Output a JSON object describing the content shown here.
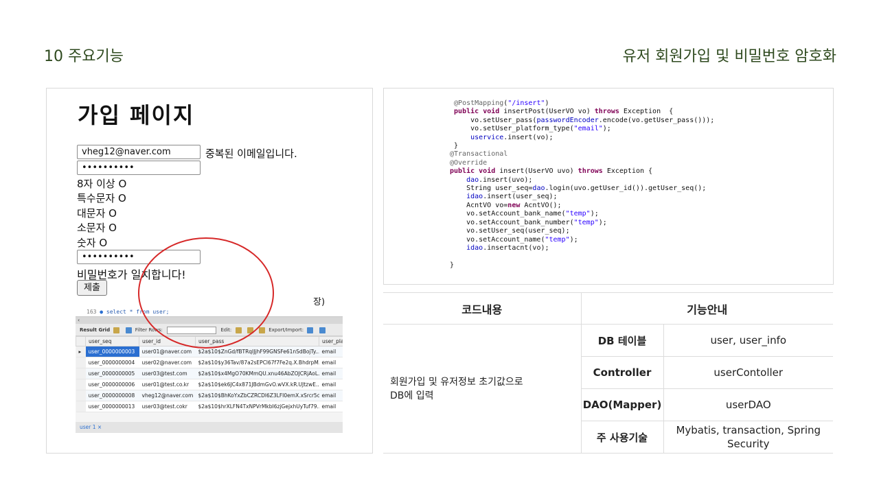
{
  "header": {
    "section": "10 주요기능",
    "topic": "유저 회원가입 및 비밀번호 암호화"
  },
  "signup": {
    "title": "가입 페이지",
    "email_value": "vheg12@naver.com",
    "email_message": "중복된 이메일입니다.",
    "password_value": "••••••••••",
    "rules": [
      "8자 이상 O",
      "특수문자 O",
      "대문자 O",
      "소문자 O",
      "숫자 O"
    ],
    "password_confirm_value": "••••••••••",
    "match_message": "비밀번호가 일치합니다!",
    "submit_label": "제출",
    "trailing_text": "장)"
  },
  "workbench": {
    "line_number": "163",
    "query": "select * from user;",
    "toolbar": {
      "result_grid": "Result Grid",
      "filter_rows": "Filter Rows:",
      "edit": "Edit:",
      "export_import": "Export/Import:"
    },
    "columns": [
      "user_seq",
      "user_id",
      "user_pass",
      "user_pla"
    ],
    "rows": [
      [
        "user_0000000003",
        "user01@naver.com",
        "$2a$10$ZnGd/fBTRqIJjhF99GNSFe61nSdBojTy...",
        "email"
      ],
      [
        "user_0000000004",
        "user02@naver.com",
        "$2a$10$y36Tav/87a2sEPCl67f7Fe2q.X.BhdrpM...",
        "email"
      ],
      [
        "user_0000000005",
        "user03@test.com",
        "$2a$10$x4MgO70KMmQU.xnu46AbZOJCRjAoL...",
        "email"
      ],
      [
        "user_0000000006",
        "user01@test.co.kr",
        "$2a$10$ek6JC4x871JBdmGvO.wVX.kR.UJtzwE...",
        "email"
      ],
      [
        "user_0000000008",
        "vheg12@naver.com",
        "$2a$10$BhKoYxZbCZRCDl6Z3LFI0emX.xSrcr5c...",
        "email"
      ],
      [
        "user_0000000013",
        "user03@test.cokr",
        "$2a$10$hrXLFN4TxNPVrMkbI6zjGejxhUyTuf79...",
        "email"
      ]
    ],
    "tab_label": "user 1 ×"
  },
  "code_lines": [
    " @PostMapping(\"/insert\")",
    " public void insertPost(UserVO vo) throws Exception  {",
    "     vo.setUser_pass(passwordEncoder.encode(vo.getUser_pass()));",
    "     vo.setUser_platform_type(\"email\");",
    "     uservice.insert(vo);",
    " }",
    "@Transactional",
    "@Override",
    "public void insert(UserVO uvo) throws Exception {",
    "    dao.insert(uvo);",
    "    String user_seq=dao.login(uvo.getUser_id()).getUser_seq();",
    "    idao.insert(user_seq);",
    "    AcntVO vo=new AcntVO();",
    "    vo.setAccount_bank_name(\"temp\");",
    "    vo.setAccount_bank_number(\"temp\");",
    "    vo.setUser_seq(user_seq);",
    "    vo.setAccount_name(\"temp\");",
    "    idao.insertacnt(vo);",
    "",
    "}"
  ],
  "info_table": {
    "col1_header": "코드내용",
    "col2_header": "기능안내",
    "description": "회원가입 및 유저정보 초기값으로\nDB에 입력",
    "rows": [
      {
        "label": "DB 테이블",
        "value": "user, user_info"
      },
      {
        "label": "Controller",
        "value": "userContoller"
      },
      {
        "label": "DAO(Mapper)",
        "value": "userDAO"
      },
      {
        "label": "주 사용기술",
        "value": "Mybatis, transaction, Spring Security"
      }
    ]
  },
  "colors": {
    "header_text": "#2f4a1f",
    "annotation_circle": "#d62828",
    "selected_row": "#2b6fd1"
  }
}
